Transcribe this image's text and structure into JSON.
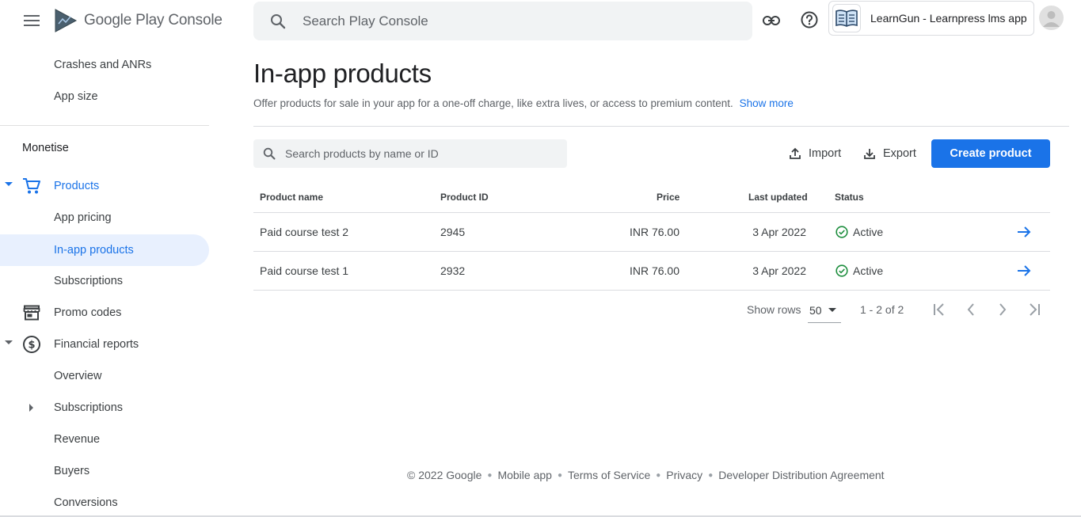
{
  "header": {
    "logo_brand": "Google Play",
    "logo_product": "Console",
    "search_placeholder": "Search Play Console",
    "app_name": "LearnGun - Learnpress lms app"
  },
  "sidebar": {
    "top_items": [
      {
        "label": "Crashes and ANRs"
      },
      {
        "label": "App size"
      }
    ],
    "section_title": "Monetise",
    "items": [
      {
        "label": "Products",
        "icon": "cart-icon",
        "expanded": true
      },
      {
        "label": "App pricing"
      },
      {
        "label": "In-app products",
        "selected": true
      },
      {
        "label": "Subscriptions"
      },
      {
        "label": "Promo codes",
        "icon": "store-icon"
      },
      {
        "label": "Financial reports",
        "icon": "dollar-icon",
        "expanded": true
      },
      {
        "label": "Overview"
      },
      {
        "label": "Subscriptions",
        "collapsed": true
      },
      {
        "label": "Revenue"
      },
      {
        "label": "Buyers"
      },
      {
        "label": "Conversions"
      }
    ]
  },
  "main": {
    "title": "In-app products",
    "description": "Offer products for sale in your app for a one-off charge, like extra lives, or access to premium content.",
    "show_more": "Show more",
    "product_search_placeholder": "Search products by name or ID",
    "import_label": "Import",
    "export_label": "Export",
    "create_label": "Create product"
  },
  "table": {
    "columns": [
      "Product name",
      "Product ID",
      "Price",
      "Last updated",
      "Status"
    ],
    "rows": [
      {
        "name": "Paid course test 2",
        "id": "2945",
        "price": "INR 76.00",
        "updated": "3 Apr 2022",
        "status": "Active"
      },
      {
        "name": "Paid course test 1",
        "id": "2932",
        "price": "INR 76.00",
        "updated": "3 Apr 2022",
        "status": "Active"
      }
    ]
  },
  "pagination": {
    "show_rows_label": "Show rows",
    "rows_value": "50",
    "range": "1 - 2 of 2"
  },
  "footer": {
    "copyright": "© 2022 Google",
    "links": [
      "Mobile app",
      "Terms of Service",
      "Privacy",
      "Developer Distribution Agreement"
    ]
  },
  "colors": {
    "accent": "#1a73e8",
    "active_bg": "#e8f0fe",
    "status_active": "#1e8e3e"
  }
}
